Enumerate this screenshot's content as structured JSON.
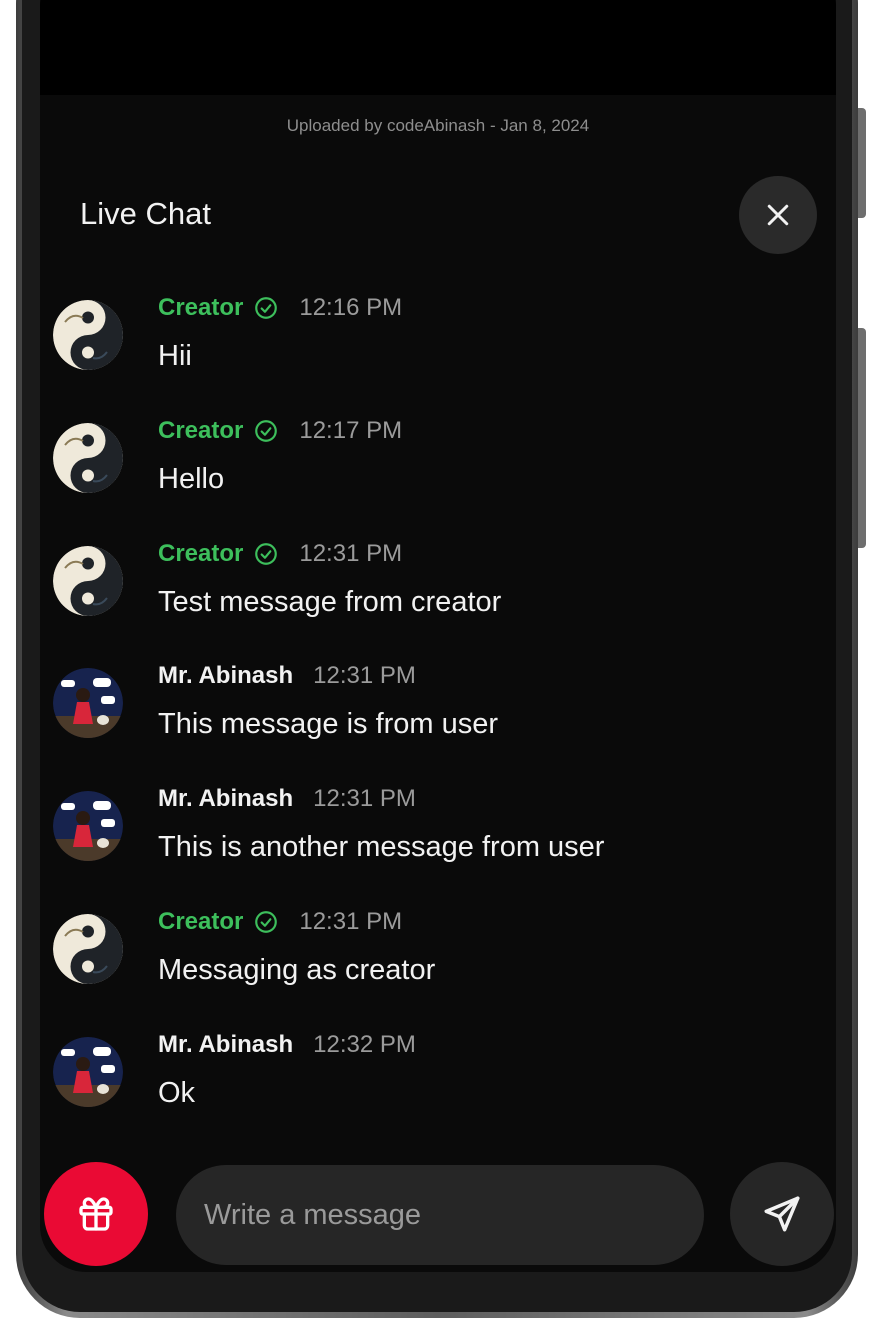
{
  "upload_info": "Uploaded by codeAbinash - Jan 8, 2024",
  "chat": {
    "title": "Live Chat",
    "close_icon": "close-icon"
  },
  "messages": [
    {
      "sender": "Creator",
      "role": "creator",
      "verified": true,
      "time": "12:16 PM",
      "text": "Hii"
    },
    {
      "sender": "Creator",
      "role": "creator",
      "verified": true,
      "time": "12:17 PM",
      "text": "Hello"
    },
    {
      "sender": "Creator",
      "role": "creator",
      "verified": true,
      "time": "12:31 PM",
      "text": "Test message from creator"
    },
    {
      "sender": "Mr. Abinash",
      "role": "user",
      "verified": false,
      "time": "12:31 PM",
      "text": "This message is from user"
    },
    {
      "sender": "Mr. Abinash",
      "role": "user",
      "verified": false,
      "time": "12:31 PM",
      "text": "This is another message from user"
    },
    {
      "sender": "Creator",
      "role": "creator",
      "verified": true,
      "time": "12:31 PM",
      "text": "Messaging as creator"
    },
    {
      "sender": "Mr. Abinash",
      "role": "user",
      "verified": false,
      "time": "12:32 PM",
      "text": "Ok"
    }
  ],
  "composer": {
    "placeholder": "Write a message",
    "gift_icon": "gift-icon",
    "send_icon": "send-icon"
  },
  "colors": {
    "accent_red": "#ea0a34",
    "creator_green": "#3dbf5c",
    "background": "#0a0a0a"
  }
}
